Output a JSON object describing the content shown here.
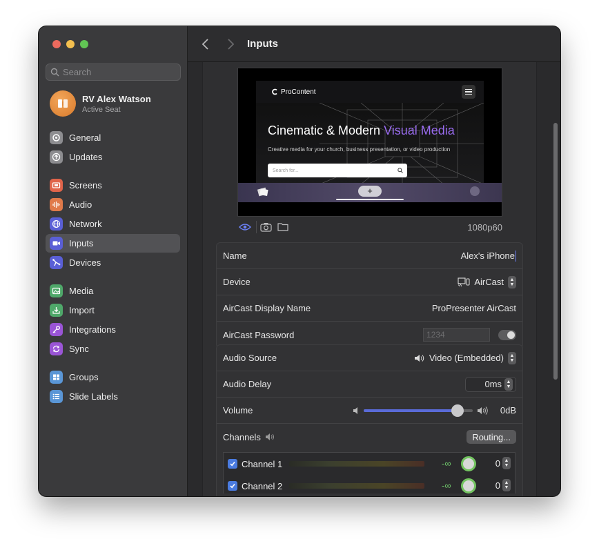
{
  "window": {
    "title": "Inputs"
  },
  "search": {
    "placeholder": "Search"
  },
  "account": {
    "name": "RV Alex Watson",
    "status": "Active Seat"
  },
  "sidebar": {
    "items": [
      {
        "label": "General"
      },
      {
        "label": "Updates"
      },
      {
        "label": "Screens"
      },
      {
        "label": "Audio"
      },
      {
        "label": "Network"
      },
      {
        "label": "Inputs"
      },
      {
        "label": "Devices"
      },
      {
        "label": "Media"
      },
      {
        "label": "Import"
      },
      {
        "label": "Integrations"
      },
      {
        "label": "Sync"
      },
      {
        "label": "Groups"
      },
      {
        "label": "Slide Labels"
      }
    ],
    "active": "Inputs"
  },
  "preview": {
    "brand": "ProContent",
    "headline_a": "Cinematic & Modern ",
    "headline_b": "Visual Media",
    "subtitle": "Creative media for your church, business presentation, or video production",
    "search_placeholder": "Search for...",
    "plus": "+",
    "resolution": "1080p60"
  },
  "input_settings": {
    "name_label": "Name",
    "name_value": "Alex's iPhone",
    "device_label": "Device",
    "device_value": "AirCast",
    "display_name_label": "AirCast Display Name",
    "display_name_value": "ProPresenter AirCast",
    "password_label": "AirCast Password",
    "password_placeholder": "1234",
    "password_enabled": false
  },
  "audio": {
    "source_label": "Audio Source",
    "source_value": "Video (Embedded)",
    "delay_label": "Audio Delay",
    "delay_value": "0ms",
    "volume_label": "Volume",
    "volume_value": "0dB",
    "volume_level": 0.86,
    "channels_label": "Channels",
    "routing_label": "Routing...",
    "channels": [
      {
        "label": "Channel 1",
        "level": "-∞",
        "value": "0",
        "enabled": true
      },
      {
        "label": "Channel 2",
        "level": "-∞",
        "value": "0",
        "enabled": true
      }
    ]
  },
  "colors": {
    "accent": "#5a6bd8",
    "meter_green": "#6ec46a",
    "visual_media": "#9a6cf0"
  }
}
